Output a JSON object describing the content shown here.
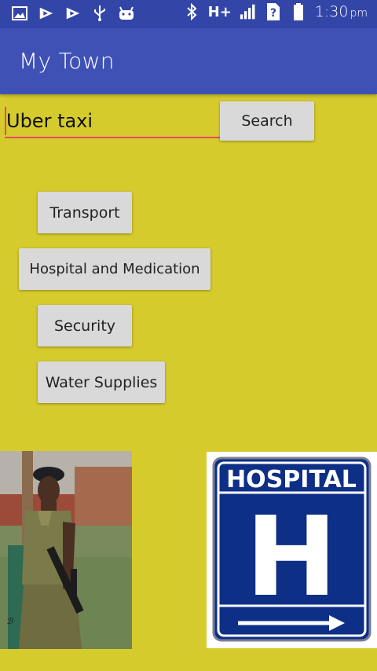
{
  "status_bar": {
    "network_type": "H+",
    "time": "1:30",
    "time_suffix": "pm",
    "icons": [
      "image-icon",
      "app-icon",
      "app-icon",
      "usb-icon",
      "android-icon",
      "bluetooth-icon",
      "signal-icon",
      "no-sim-icon",
      "battery-icon"
    ]
  },
  "app_bar": {
    "title": "My Town"
  },
  "search": {
    "value": "Uber taxi",
    "button_label": "Search"
  },
  "categories": {
    "transport": "Transport",
    "hospital": "Hospital and Medication",
    "security": "Security",
    "water": "Water Supplies"
  },
  "images": {
    "hospital_sign_text": "HOSPITAL",
    "hospital_sign_letter": "H"
  },
  "colors": {
    "status_bar": "#3346a8",
    "app_bar": "#3f51b5",
    "background": "#d6cb2c",
    "input_underline": "#e84a5f",
    "button": "#d9d9d9",
    "hospital_sign_blue": "#0e2f86"
  }
}
